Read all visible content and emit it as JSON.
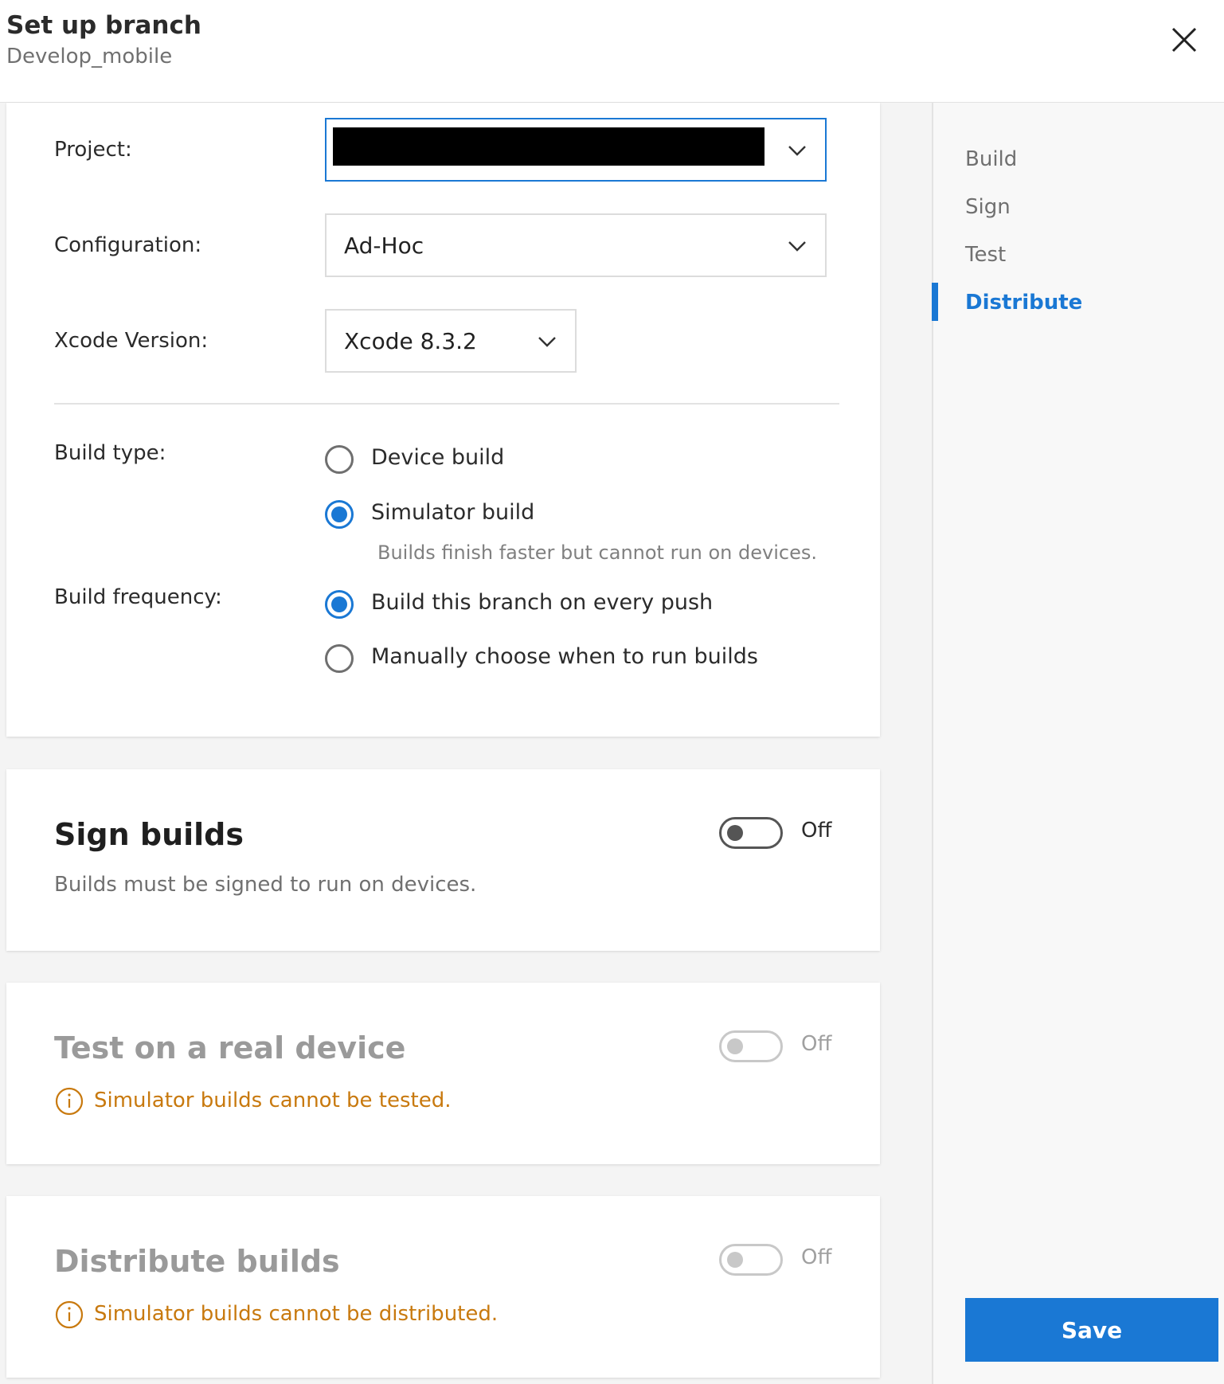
{
  "header": {
    "title": "Set up branch",
    "subtitle": "Develop_mobile"
  },
  "config": {
    "project_label": "Project:",
    "project_value": "",
    "configuration_label": "Configuration:",
    "configuration_value": "Ad-Hoc",
    "xcode_label": "Xcode Version:",
    "xcode_value": "Xcode 8.3.2",
    "build_type_label": "Build type:",
    "build_type_options": [
      {
        "label": "Device build",
        "checked": false
      },
      {
        "label": "Simulator build",
        "checked": true
      }
    ],
    "simulator_hint": "Builds finish faster but cannot run on devices.",
    "frequency_label": "Build frequency:",
    "frequency_options": [
      {
        "label": "Build this branch on every push",
        "checked": true
      },
      {
        "label": "Manually choose when to run builds",
        "checked": false
      }
    ]
  },
  "sign": {
    "title": "Sign builds",
    "description": "Builds must be signed to run on devices.",
    "toggle_state": "Off"
  },
  "test": {
    "title": "Test on a real device",
    "warning": "Simulator builds cannot be tested.",
    "toggle_state": "Off"
  },
  "distribute": {
    "title": "Distribute builds",
    "warning": "Simulator builds cannot be distributed.",
    "toggle_state": "Off"
  },
  "sidenav": {
    "items": [
      "Build",
      "Sign",
      "Test",
      "Distribute"
    ],
    "active": "Distribute",
    "save_label": "Save"
  },
  "colors": {
    "accent": "#1a78d4",
    "warning": "#c8790e"
  },
  "icons": [
    "close-icon",
    "chevron-down-icon",
    "info-circle-icon"
  ]
}
